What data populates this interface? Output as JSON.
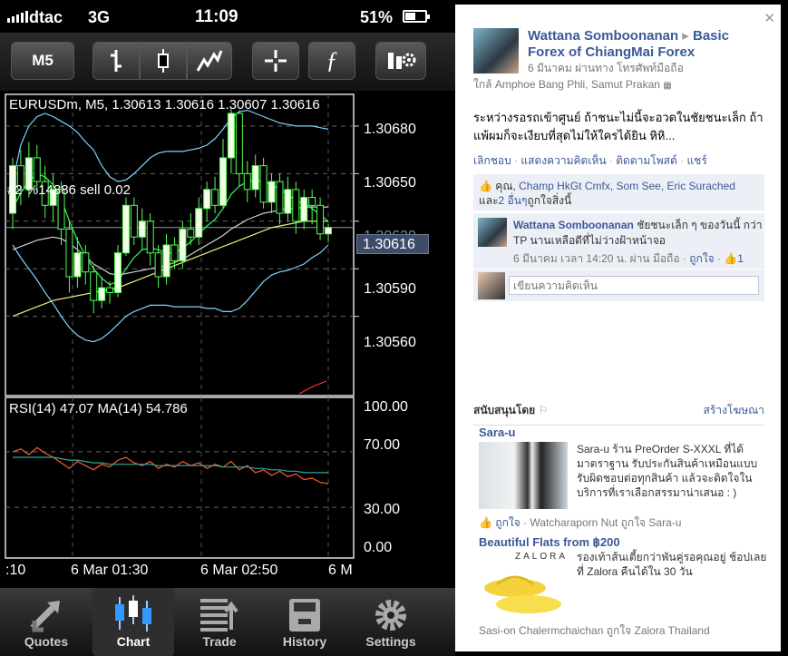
{
  "status": {
    "carrier": "dtac",
    "network": "3G",
    "time": "11:09",
    "battery": "51%"
  },
  "toolbar": {
    "timeframe": "M5"
  },
  "chart_data": {
    "type": "candlestick",
    "title": "EURUSDm, M5, 1.30613 1.30616 1.30607 1.30616",
    "order_label": "#2 %14886 sell 0.02",
    "current_price": "1.30616",
    "yticks": [
      "1.30680",
      "1.30650",
      "1.30620",
      "1.30590",
      "1.30560"
    ],
    "ylim": [
      1.3051,
      1.307
    ],
    "xticks": [
      ":10",
      "6 Mar 01:30",
      "6 Mar 02:50",
      "6 M"
    ],
    "candles": [
      [
        1.30625,
        1.30655,
        1.3066,
        1.30615
      ],
      [
        1.30655,
        1.3064,
        1.30665,
        1.3063
      ],
      [
        1.3064,
        1.3066,
        1.3067,
        1.30635
      ],
      [
        1.3066,
        1.30645,
        1.30668,
        1.30638
      ],
      [
        1.30645,
        1.3063,
        1.30655,
        1.30622
      ],
      [
        1.3063,
        1.3064,
        1.3065,
        1.3062
      ],
      [
        1.3064,
        1.30615,
        1.30645,
        1.30605
      ],
      [
        1.30615,
        1.30585,
        1.3062,
        1.30575
      ],
      [
        1.30585,
        1.306,
        1.3061,
        1.30578
      ],
      [
        1.306,
        1.30588,
        1.30605,
        1.3058
      ],
      [
        1.30588,
        1.3057,
        1.30592,
        1.30562
      ],
      [
        1.3057,
        1.30578,
        1.30585,
        1.30565
      ],
      [
        1.30578,
        1.30575,
        1.30582,
        1.30568
      ],
      [
        1.30575,
        1.306,
        1.30605,
        1.30572
      ],
      [
        1.306,
        1.3063,
        1.30635,
        1.30598
      ],
      [
        1.3063,
        1.3061,
        1.30635,
        1.30605
      ],
      [
        1.3061,
        1.3062,
        1.30628,
        1.30602
      ],
      [
        1.3062,
        1.306,
        1.30625,
        1.30592
      ],
      [
        1.306,
        1.30585,
        1.30605,
        1.30578
      ],
      [
        1.30585,
        1.30605,
        1.30612,
        1.3058
      ],
      [
        1.30605,
        1.30595,
        1.3061,
        1.3059
      ],
      [
        1.30595,
        1.30615,
        1.3062,
        1.3059
      ],
      [
        1.30615,
        1.3061,
        1.30625,
        1.30605
      ],
      [
        1.3061,
        1.30628,
        1.30635,
        1.30605
      ],
      [
        1.30628,
        1.3064,
        1.30645,
        1.3062
      ],
      [
        1.3064,
        1.3063,
        1.30648,
        1.30625
      ],
      [
        1.3063,
        1.3066,
        1.30672,
        1.30628
      ],
      [
        1.3066,
        1.30688,
        1.30692,
        1.3065
      ],
      [
        1.30688,
        1.3065,
        1.3069,
        1.30642
      ],
      [
        1.3065,
        1.3064,
        1.30658,
        1.30632
      ],
      [
        1.3064,
        1.30655,
        1.30662,
        1.30635
      ],
      [
        1.30655,
        1.30632,
        1.3066,
        1.30628
      ],
      [
        1.30632,
        1.30645,
        1.3065,
        1.30625
      ],
      [
        1.30645,
        1.30625,
        1.3065,
        1.30618
      ],
      [
        1.30625,
        1.3064,
        1.30648,
        1.3062
      ],
      [
        1.3064,
        1.3062,
        1.30645,
        1.30612
      ],
      [
        1.3062,
        1.30635,
        1.3064,
        1.30615
      ],
      [
        1.30635,
        1.3063,
        1.3064,
        1.30618
      ],
      [
        1.3063,
        1.30612,
        1.30635,
        1.30608
      ],
      [
        1.30612,
        1.30616,
        1.30618,
        1.30607
      ]
    ],
    "bands_upper": [
      1.30645,
      1.30668,
      1.3068,
      1.30686,
      1.30688,
      1.30686,
      1.30683,
      1.3068,
      1.30676,
      1.3067,
      1.30665,
      1.30655,
      1.30648,
      1.30645,
      1.30646,
      1.3065,
      1.30655,
      1.3066,
      1.30663,
      1.30664,
      1.30664,
      1.30664,
      1.30665,
      1.30666,
      1.30668,
      1.30672,
      1.30678,
      1.30685,
      1.30689,
      1.3069,
      1.30688,
      1.30686,
      1.30684,
      1.30682,
      1.30681,
      1.3068,
      1.3068,
      1.3068,
      1.30679,
      1.30678
    ],
    "bands_lower": [
      1.30605,
      1.30597,
      1.3059,
      1.30583,
      1.30575,
      1.30568,
      1.3056,
      1.30553,
      1.30548,
      1.30545,
      1.30544,
      1.30546,
      1.3055,
      1.30555,
      1.3056,
      1.30563,
      1.30565,
      1.30567,
      1.30567,
      1.30567,
      1.30566,
      1.30566,
      1.30566,
      1.30566,
      1.30565,
      1.30565,
      1.30563,
      1.30563,
      1.30565,
      1.3057,
      1.30576,
      1.30582,
      1.30586,
      1.30588,
      1.30589,
      1.30591,
      1.30593,
      1.30597,
      1.306,
      1.30605
    ],
    "ma_fast": [
      1.30628,
      1.30638,
      1.30645,
      1.3065,
      1.30648,
      1.30643,
      1.30634,
      1.3062,
      1.30608,
      1.30598,
      1.3059,
      1.30584,
      1.3058,
      1.30582,
      1.3059,
      1.30597,
      1.30602,
      1.30603,
      1.30602,
      1.306,
      1.306,
      1.30603,
      1.30607,
      1.30612,
      1.30617,
      1.30621,
      1.30628,
      1.30637,
      1.30642,
      1.30645,
      1.30646,
      1.30645,
      1.30643,
      1.3064,
      1.30637,
      1.30633,
      1.30631,
      1.30628,
      1.30624,
      1.3062
    ],
    "ma_slow": [
      1.30602,
      1.30604,
      1.30606,
      1.30608,
      1.30609,
      1.3061,
      1.30609,
      1.30606,
      1.30602,
      1.30598,
      1.30593,
      1.3059,
      1.30587,
      1.30586,
      1.30587,
      1.30588,
      1.30589,
      1.3059,
      1.30591,
      1.30592,
      1.30594,
      1.30596,
      1.30599,
      1.30602,
      1.30605,
      1.30608,
      1.30611,
      1.30615,
      1.30618,
      1.30621,
      1.30623,
      1.30625,
      1.30626,
      1.30627,
      1.30628,
      1.30628,
      1.30629,
      1.30629,
      1.30629,
      1.30629
    ],
    "ma_yellow": [
      1.3056,
      1.30562,
      1.30564,
      1.30566,
      1.30568,
      1.3057,
      1.30571,
      1.30572,
      1.30573,
      1.30574,
      1.30575,
      1.30576,
      1.30577,
      1.30578,
      1.3058,
      1.30582,
      1.30584,
      1.30586,
      1.30588,
      1.3059,
      1.30592,
      1.30594,
      1.30596,
      1.30598,
      1.306,
      1.30602,
      1.30604,
      1.30606,
      1.30608,
      1.3061,
      1.30612,
      1.30614,
      1.30616,
      1.30617,
      1.30618,
      1.30619,
      1.3062,
      1.3062,
      1.3062,
      1.3062
    ],
    "rsi_title": "RSI(14) 47.07 MA(14) 54.786",
    "rsi_yticks": [
      "100.00",
      "70.00",
      "30.00",
      "0.00"
    ],
    "rsi": [
      70,
      72,
      68,
      73,
      69,
      66,
      62,
      58,
      63,
      60,
      57,
      61,
      59,
      64,
      66,
      62,
      60,
      63,
      58,
      61,
      59,
      63,
      60,
      62,
      58,
      61,
      59,
      63,
      57,
      60,
      55,
      57,
      53,
      56,
      52,
      54,
      50,
      51,
      48,
      47
    ],
    "rsi_ma": [
      66,
      66,
      66,
      66,
      66,
      66,
      65,
      64,
      64,
      63,
      62,
      62,
      61,
      61,
      61,
      61,
      61,
      61,
      60,
      60,
      60,
      60,
      60,
      60,
      60,
      60,
      59,
      59,
      59,
      59,
      58,
      58,
      57,
      57,
      56,
      56,
      55,
      55,
      55,
      55
    ]
  },
  "tabs": [
    {
      "label": "Quotes",
      "icon": "quotes-arrows-icon"
    },
    {
      "label": "Chart",
      "icon": "candles-icon"
    },
    {
      "label": "Trade",
      "icon": "trade-list-icon"
    },
    {
      "label": "History",
      "icon": "history-box-icon"
    },
    {
      "label": "Settings",
      "icon": "gear-icon"
    }
  ],
  "fb": {
    "author": "Wattana Somboonanan",
    "target": "Basic Forex of ChiangMai Forex",
    "meta": "6 มีนาคม ผ่านทาง โทรศัพท์มือถือ",
    "location": "ใกล้ Amphoe Bang Phli, Samut Prakan",
    "body": "ระหว่างรอรถเข้าศูนย์ ถ้าชนะไม่นี้จะอวดในชัยชนะเล็ก ถ้าแพ้ผมก็จะเงียบที่สุดไม่ให้ใครได้ยิน หิหิ...",
    "actions": [
      "เลิกชอบ",
      "แสดงความคิดเห็น",
      "ติดตามโพสต์",
      "แชร์"
    ],
    "likes_you": "คุณ,",
    "likes_names": [
      "Champ HkGt Cmfx,",
      "Som See,",
      "Eric Surached"
    ],
    "likes_and": "และ",
    "likes_more": "2 อื่นๆ",
    "likes_tail": "ถูกใจสิ่งนี้",
    "comment_author": "Wattana Somboonanan",
    "comment_text": "ชัยชนะเล็ก ๆ ของวันนี้ กว่า TP นานเหลือดีที่ไม่ว่างฝ้าหน้าจอ",
    "comment_meta": "6 มีนาคม เวลา 14:20 น. ผ่าน มือถือ ·",
    "comment_like": "ถูกใจ",
    "comment_count": "1",
    "write_placeholder": "เขียนความคิดเห็น",
    "sponsored": "สนับสนุนโดย",
    "create_ad": "สร้างโฆษณา",
    "ad1": {
      "title": "Sara-u",
      "text": "Sara-u ร้าน PreOrder S-XXXL ที่ได้มาตราฐาน รับประกันสินค้าเหมือนแบบ รับผิดชอบต่อทุกสินค้า แล้วจะติดใจในบริการที่เราเลือกสรรมาน่าเสนอ : )",
      "like": "ถูกใจ",
      "social": "· Watcharaporn Nut ถูกใจ Sara-u"
    },
    "ad2": {
      "title": "Beautiful Flats from ฿200",
      "brand": "ZALORA",
      "text": "รองเท้าส้นเตี้ยกว่าพันคู่รอคุณอยู่ ช้อปเลยที่ Zalora คืนได้ใน 30 วัน",
      "social": "Sasi-on Chalermchaichan ถูกใจ Zalora Thailand"
    }
  }
}
